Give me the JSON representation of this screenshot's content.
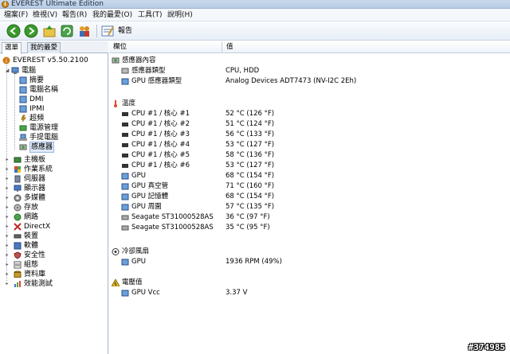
{
  "window": {
    "title": "EVEREST Ultimate Edition"
  },
  "menu": [
    "檔案(F)",
    "檢視(V)",
    "報告(R)",
    "我的最愛(O)",
    "工具(T)",
    "說明(H)"
  ],
  "toolbar": {
    "report_label": "報告"
  },
  "left_panel": {
    "tabs": [
      "選單",
      "我的最愛"
    ],
    "root": "EVEREST v5.50.2100",
    "computer": "電腦",
    "computer_children": [
      "摘要",
      "電腦名稱",
      "DMI",
      "IPMI",
      "超頻",
      "電源管理",
      "手提電腦",
      "感應器"
    ],
    "categories": [
      "主機板",
      "作業系統",
      "伺服器",
      "顯示器",
      "多媒體",
      "存放",
      "網路",
      "DirectX",
      "裝置",
      "軟體",
      "安全性",
      "組態",
      "資料庫",
      "效能測試"
    ]
  },
  "right_panel": {
    "columns": {
      "field": "欄位",
      "value": "值"
    },
    "sections": {
      "sensor_props": "感應器內容",
      "temperature": "溫度",
      "cooling_fans": "冷卻風扇",
      "voltage": "電壓值"
    },
    "sensor_props": [
      {
        "label": "感應器類型",
        "value": "CPU, HDD"
      },
      {
        "label": "GPU 感應器類型",
        "value": "Analog Devices ADT7473  (NV-I2C 2Eh)"
      }
    ],
    "temperatures": [
      {
        "label": "CPU #1 / 核心 #1",
        "value": "52 °C  (126 °F)"
      },
      {
        "label": "CPU #1 / 核心 #2",
        "value": "51 °C  (124 °F)"
      },
      {
        "label": "CPU #1 / 核心 #3",
        "value": "56 °C  (133 °F)"
      },
      {
        "label": "CPU #1 / 核心 #4",
        "value": "53 °C  (127 °F)"
      },
      {
        "label": "CPU #1 / 核心 #5",
        "value": "58 °C  (136 °F)"
      },
      {
        "label": "CPU #1 / 核心 #6",
        "value": "53 °C  (127 °F)"
      },
      {
        "label": "GPU",
        "value": "68 °C  (154 °F)"
      },
      {
        "label": "GPU 真空管",
        "value": "71 °C  (160 °F)"
      },
      {
        "label": "GPU 記憶體",
        "value": "68 °C  (154 °F)"
      },
      {
        "label": "GPU 周圍",
        "value": "57 °C  (135 °F)"
      },
      {
        "label": "Seagate ST31000528AS",
        "value": "36 °C  (97 °F)"
      },
      {
        "label": "Seagate ST31000528AS",
        "value": "35 °C  (95 °F)"
      }
    ],
    "fans": [
      {
        "label": "GPU",
        "value": "1936 RPM  (49%)"
      }
    ],
    "voltages": [
      {
        "label": "GPU Vcc",
        "value": "3.37 V"
      }
    ]
  },
  "watermark": "#374985"
}
